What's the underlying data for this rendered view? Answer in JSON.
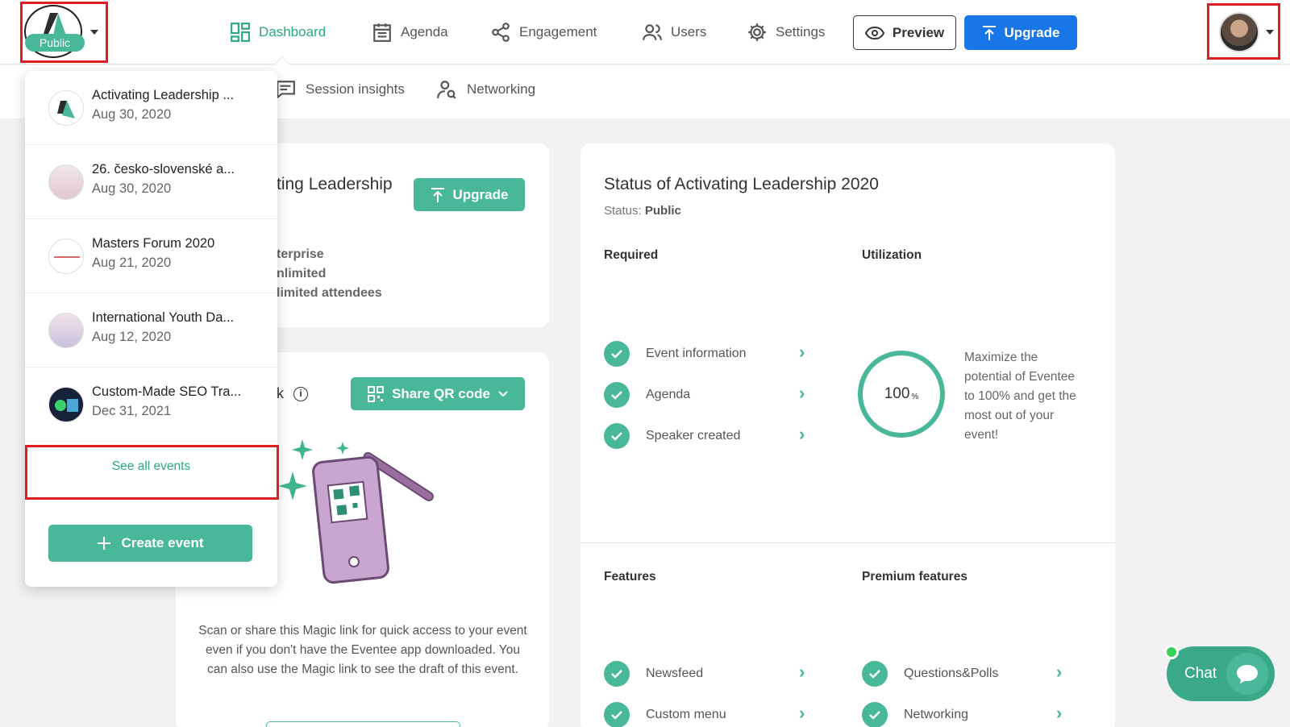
{
  "header": {
    "status_pill": "Public",
    "nav": [
      {
        "label": "Dashboard",
        "icon": "dashboard-grid-icon",
        "active": true
      },
      {
        "label": "Agenda",
        "icon": "calendar-icon"
      },
      {
        "label": "Engagement",
        "icon": "share-nodes-icon"
      },
      {
        "label": "Users",
        "icon": "users-icon"
      },
      {
        "label": "Settings",
        "icon": "gear-icon"
      }
    ],
    "preview_label": "Preview",
    "upgrade_label": "Upgrade"
  },
  "subnav": {
    "items": [
      {
        "label": "Session insights",
        "icon": "chat-insights-icon"
      },
      {
        "label": "Networking",
        "icon": "networking-search-icon"
      }
    ]
  },
  "left_card": {
    "event_title_partial": "ting Leadership",
    "upgrade_label": "Upgrade",
    "plan_lines": [
      "terprise",
      "nlimited",
      "limited attendees"
    ]
  },
  "magic_card": {
    "title_partial": "k",
    "share_label": "Share QR code",
    "description": "Scan or share this Magic link for quick access to your event even if you don't have the Eventee app downloaded. You can also use the Magic link to see the draft of this event."
  },
  "status": {
    "title": "Status of Activating Leadership 2020",
    "status_label": "Status:",
    "status_value": "Public",
    "required_heading": "Required",
    "required_items": [
      "Event information",
      "Agenda",
      "Speaker created"
    ],
    "utilization_heading": "Utilization",
    "utilization_value": "100",
    "utilization_unit": "%",
    "utilization_text": "Maximize the potential of Eventee to 100% and get the most out of your event!",
    "features_heading": "Features",
    "features_items": [
      "Newsfeed",
      "Custom menu"
    ],
    "premium_heading": "Premium features",
    "premium_items": [
      "Questions&Polls",
      "Networking"
    ]
  },
  "dropdown": {
    "events": [
      {
        "name": "Activating Leadership ...",
        "date": "Aug 30, 2020"
      },
      {
        "name": "26. česko-slovenské a...",
        "date": "Aug 30, 2020"
      },
      {
        "name": "Masters Forum 2020",
        "date": "Aug 21, 2020"
      },
      {
        "name": "International Youth Da...",
        "date": "Aug 12, 2020"
      },
      {
        "name": "Custom-Made SEO Tra...",
        "date": "Dec 31, 2021"
      }
    ],
    "see_all_label": "See all events",
    "create_label": "Create event"
  },
  "chat": {
    "label": "Chat"
  },
  "colors": {
    "accent": "#49b89a",
    "primary_blue": "#1976e6",
    "highlight": "#e02020"
  }
}
